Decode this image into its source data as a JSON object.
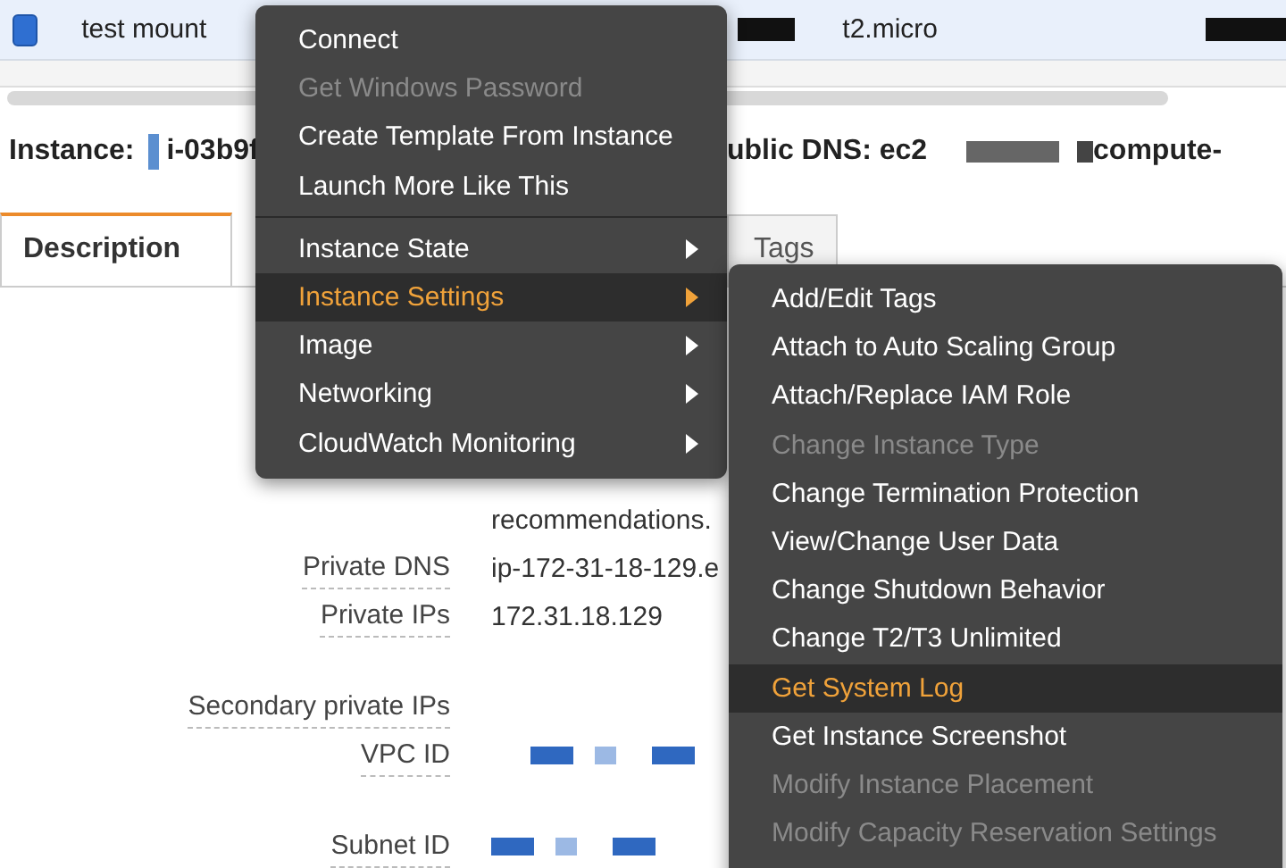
{
  "instance_row": {
    "checked": true,
    "name": "test mount",
    "type": "t2.micro"
  },
  "instance_bar": {
    "label": "Instance:",
    "id": "i-03b9f",
    "dns_label": "ublic DNS: ec2",
    "dns_suffix": "compute-"
  },
  "tabs": [
    {
      "label": "Description",
      "selected": true
    },
    {
      "label": "Tags",
      "selected": false
    }
  ],
  "details": [
    {
      "kind": "text",
      "value": "recommendations."
    },
    {
      "kind": "text",
      "label": "Private DNS",
      "value": "ip-172-31-18-129.e"
    },
    {
      "kind": "text",
      "label": "Private IPs",
      "value": "172.31.18.129"
    },
    {
      "kind": "text",
      "label": "Secondary private IPs"
    },
    {
      "kind": "redacted",
      "label": "VPC ID"
    },
    {
      "kind": "redacted",
      "label": "Subnet ID"
    }
  ],
  "context_menu": {
    "items": [
      {
        "kind": "item",
        "label": "Connect",
        "disabled": false,
        "highlighted": false,
        "submenu": false
      },
      {
        "kind": "item",
        "label": "Get Windows Password",
        "disabled": true,
        "highlighted": false,
        "submenu": false
      },
      {
        "kind": "item",
        "label": "Create Template From Instance",
        "disabled": false,
        "highlighted": false,
        "submenu": false
      },
      {
        "kind": "item",
        "label": "Launch More Like This",
        "disabled": false,
        "highlighted": false,
        "submenu": false
      },
      {
        "kind": "divider"
      },
      {
        "kind": "item",
        "label": "Instance State",
        "disabled": false,
        "highlighted": false,
        "submenu": true
      },
      {
        "kind": "item",
        "label": "Instance Settings",
        "disabled": false,
        "highlighted": true,
        "submenu": true
      },
      {
        "kind": "item",
        "label": "Image",
        "disabled": false,
        "highlighted": false,
        "submenu": true
      },
      {
        "kind": "item",
        "label": "Networking",
        "disabled": false,
        "highlighted": false,
        "submenu": true
      },
      {
        "kind": "item",
        "label": "CloudWatch Monitoring",
        "disabled": false,
        "highlighted": false,
        "submenu": true
      }
    ]
  },
  "submenu": {
    "items": [
      {
        "label": "Add/Edit Tags",
        "disabled": false,
        "highlighted": false
      },
      {
        "label": "Attach to Auto Scaling Group",
        "disabled": false,
        "highlighted": false
      },
      {
        "label": "Attach/Replace IAM Role",
        "disabled": false,
        "highlighted": false
      },
      {
        "label": "Change Instance Type",
        "disabled": true,
        "highlighted": false
      },
      {
        "label": "Change Termination Protection",
        "disabled": false,
        "highlighted": false
      },
      {
        "label": "View/Change User Data",
        "disabled": false,
        "highlighted": false
      },
      {
        "label": "Change Shutdown Behavior",
        "disabled": false,
        "highlighted": false
      },
      {
        "label": "Change T2/T3 Unlimited",
        "disabled": false,
        "highlighted": false
      },
      {
        "label": "Get System Log",
        "disabled": false,
        "highlighted": true
      },
      {
        "label": "Get Instance Screenshot",
        "disabled": false,
        "highlighted": false
      },
      {
        "label": "Modify Instance Placement",
        "disabled": true,
        "highlighted": false
      },
      {
        "label": "Modify Capacity Reservation Settings",
        "disabled": true,
        "highlighted": false
      }
    ]
  }
}
